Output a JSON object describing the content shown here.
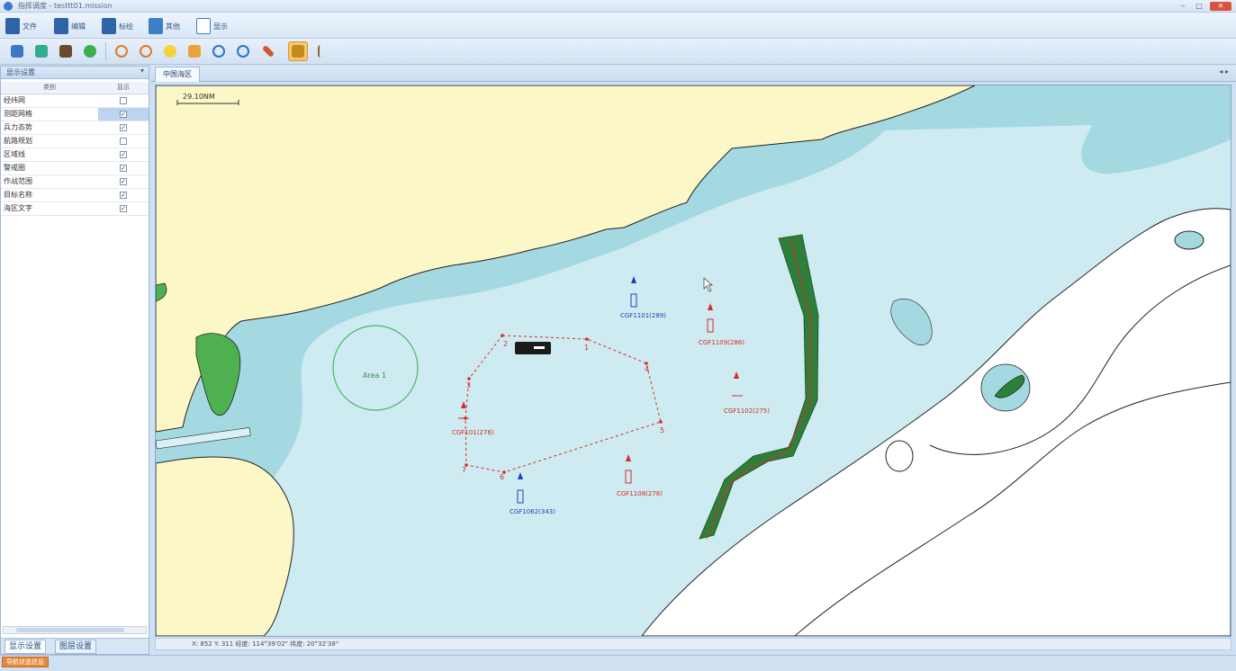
{
  "window": {
    "title": "指挥调度 - testtt01.mission",
    "controls": [
      "‒",
      "□",
      "✕"
    ]
  },
  "menu": [
    {
      "label": "文件",
      "icon": "file-icon"
    },
    {
      "label": "编辑",
      "icon": "clipboard-icon"
    },
    {
      "label": "标绘",
      "icon": "pen-icon"
    },
    {
      "label": "其他",
      "icon": "envelope-icon"
    },
    {
      "label": "显示",
      "icon": "display-icon"
    }
  ],
  "toolbar": [
    {
      "icon": "new-file-icon",
      "color": "#3a7ac4"
    },
    {
      "icon": "open-file-icon",
      "color": "#2fae8e"
    },
    {
      "icon": "save-icon",
      "color": "#6a4b2d"
    },
    {
      "icon": "globe-icon",
      "color": "#3cae4a"
    },
    {
      "icon": "zoom-in-icon",
      "color": "#e07a2a"
    },
    {
      "icon": "zoom-out-icon",
      "color": "#e07a2a"
    },
    {
      "icon": "light-bulb-icon",
      "color": "#f4d33a"
    },
    {
      "icon": "pan-hand-icon",
      "color": "#e9a53c"
    },
    {
      "icon": "refresh-icon",
      "color": "#2f73c2"
    },
    {
      "icon": "full-extent-icon",
      "color": "#2f73c2"
    },
    {
      "icon": "measure-ruler-icon",
      "color": "#d2562e"
    },
    {
      "icon": "select-tool-icon",
      "color": "#c58a1e",
      "active": true
    },
    {
      "icon": "flag-icon",
      "color": "#8a6a2a"
    }
  ],
  "left_panel": {
    "title": "显示设置",
    "pin": "▾",
    "columns": [
      "类别",
      "显示"
    ],
    "rows": [
      {
        "label": "经纬网",
        "checked": false
      },
      {
        "label": "测距网格",
        "checked": true
      },
      {
        "label": "兵力态势",
        "checked": true
      },
      {
        "label": "航路规划",
        "checked": false
      },
      {
        "label": "区域线",
        "checked": true
      },
      {
        "label": "警戒圈",
        "checked": true
      },
      {
        "label": "作战范围",
        "checked": true
      },
      {
        "label": "目标名称",
        "checked": true
      },
      {
        "label": "海区文字",
        "checked": true
      }
    ],
    "tabs": [
      "显示设置",
      "图层设置"
    ]
  },
  "doc_tab": "中国海区",
  "doc_controls": "◂ ▸",
  "map": {
    "scale_text": "29.10NM",
    "area_label": "Area 1",
    "route_points": [
      "1",
      "2",
      "3",
      "4",
      "5",
      "6",
      "7"
    ],
    "targets": [
      {
        "label": "CGF1101(289)",
        "color": "#2140b8"
      },
      {
        "label": "CGF1109(286)",
        "color": "#d62a2a"
      },
      {
        "label": "CGF1102(275)",
        "color": "#d62a2a"
      },
      {
        "label": "CGF101(276)",
        "color": "#d62a2a"
      },
      {
        "label": "CGF1108(278)",
        "color": "#d62a2a"
      },
      {
        "label": "CGF1062(343)",
        "color": "#2140b8"
      }
    ],
    "colors": {
      "land": "#fbf7c6",
      "shallow": "#a5d9e2",
      "medium": "#cdebf0",
      "deep": "#ffffff",
      "corridor": "#2e7f3a",
      "route": "#d92c2c"
    }
  },
  "status": "X: 852   Y: 311   经度: 114°39'02\"   纬度: 20°32'38\"",
  "bottom_button": "导航状态信息"
}
